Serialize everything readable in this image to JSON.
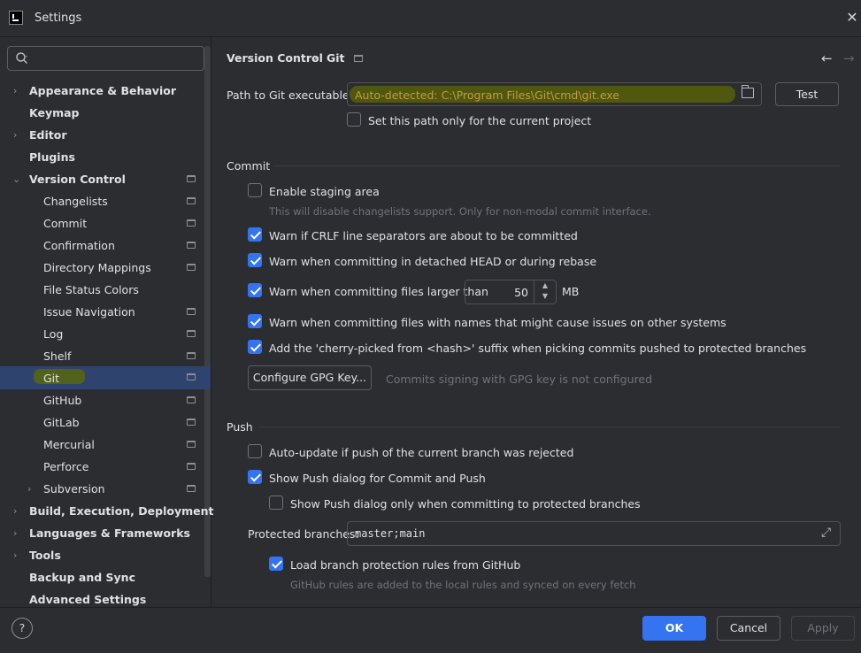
{
  "window": {
    "title": "Settings"
  },
  "sidebar": {
    "search_placeholder": "",
    "items": [
      {
        "label": "Appearance & Behavior"
      },
      {
        "label": "Keymap"
      },
      {
        "label": "Editor"
      },
      {
        "label": "Plugins"
      },
      {
        "label": "Version Control"
      },
      {
        "label": "Changelists"
      },
      {
        "label": "Commit"
      },
      {
        "label": "Confirmation"
      },
      {
        "label": "Directory Mappings"
      },
      {
        "label": "File Status Colors"
      },
      {
        "label": "Issue Navigation"
      },
      {
        "label": "Log"
      },
      {
        "label": "Shelf"
      },
      {
        "label": "Git"
      },
      {
        "label": "GitHub"
      },
      {
        "label": "GitLab"
      },
      {
        "label": "Mercurial"
      },
      {
        "label": "Perforce"
      },
      {
        "label": "Subversion"
      },
      {
        "label": "Build, Execution, Deployment"
      },
      {
        "label": "Languages & Frameworks"
      },
      {
        "label": "Tools"
      },
      {
        "label": "Backup and Sync"
      },
      {
        "label": "Advanced Settings"
      }
    ]
  },
  "breadcrumb": {
    "parent": "Version Control",
    "current": "Git"
  },
  "git": {
    "path_label": "Path to Git executable:",
    "path_value": "Auto-detected: C:\\Program Files\\Git\\cmd\\git.exe",
    "test_label": "Test",
    "path_project_only": "Set this path only for the current project"
  },
  "commit": {
    "title": "Commit",
    "staging": "Enable staging area",
    "staging_hint": "This will disable changelists support. Only for non-modal commit interface.",
    "crlf": "Warn if CRLF line separators are about to be committed",
    "detached": "Warn when committing in detached HEAD or during rebase",
    "large_files": "Warn when committing files larger than",
    "large_files_value": "50",
    "large_files_unit": "MB",
    "names": "Warn when committing files with names that might cause issues on other systems",
    "cherry": "Add the 'cherry-picked from <hash>' suffix when picking commits pushed to protected branches",
    "gpg_button": "Configure GPG Key...",
    "gpg_status": "Commits signing with GPG key is not configured"
  },
  "push": {
    "title": "Push",
    "auto_update": "Auto-update if push of the current branch was rejected",
    "show_dialog": "Show Push dialog for Commit and Push",
    "show_dialog_protected": "Show Push dialog only when committing to protected branches",
    "protected_label": "Protected branches:",
    "protected_value": "master;main",
    "load_rules": "Load branch protection rules from GitHub",
    "load_rules_hint": "GitHub rules are added to the local rules and synced on every fetch"
  },
  "buttons": {
    "ok": "OK",
    "cancel": "Cancel",
    "apply": "Apply",
    "help": "?"
  },
  "colors": {
    "accent": "#3574f0",
    "selection": "#2e436e",
    "highlight": "#5f6b00"
  }
}
